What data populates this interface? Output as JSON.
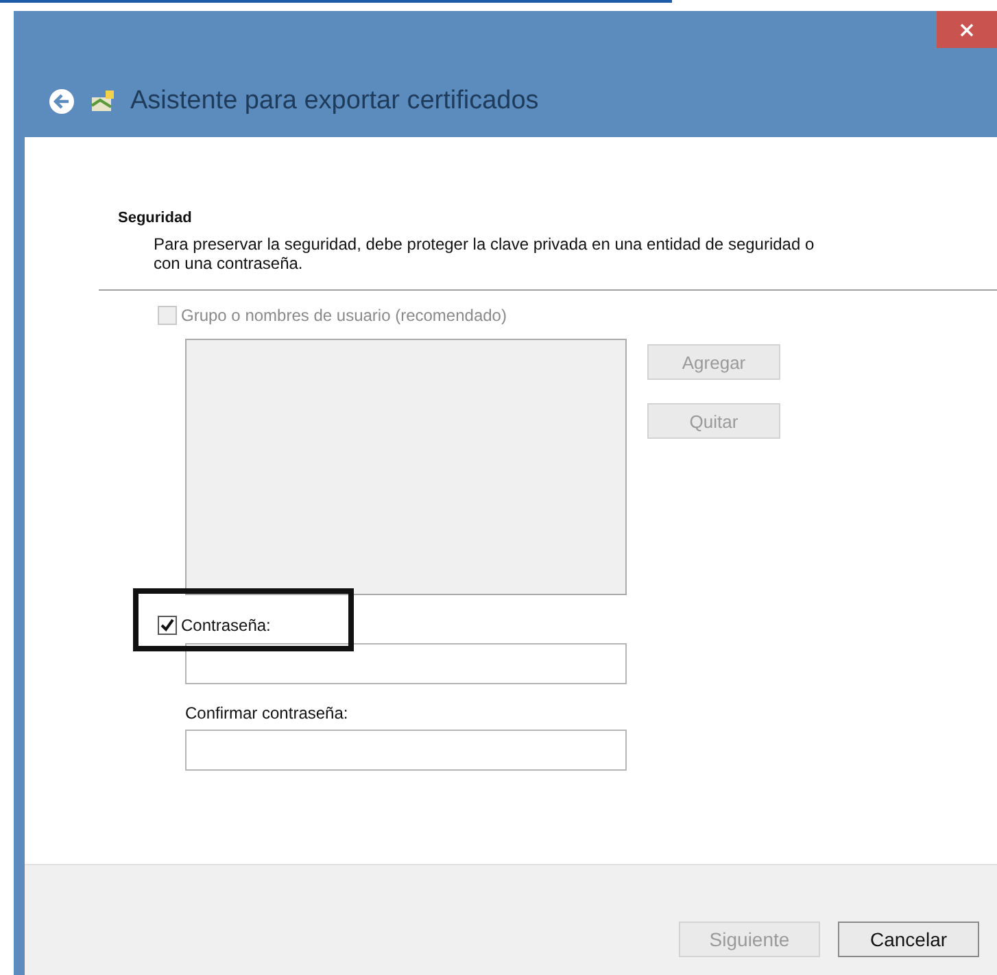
{
  "window": {
    "title": "Asistente para exportar certificados"
  },
  "section": {
    "heading": "Seguridad",
    "description": "Para preservar la seguridad, debe proteger la clave privada en una entidad de seguridad o con una contraseña."
  },
  "group_option": {
    "label": "Grupo o nombres de usuario (recomendado)",
    "checked": false,
    "disabled": true
  },
  "side_buttons": [
    {
      "label": "Agregar",
      "disabled": true
    },
    {
      "label": "Quitar",
      "disabled": true
    }
  ],
  "password_option": {
    "label": "Contraseña:",
    "checked": true,
    "disabled": false,
    "highlighted": true
  },
  "confirm": {
    "label": "Confirmar contraseña:"
  },
  "footer_buttons": [
    {
      "label": "Siguiente",
      "disabled": true
    },
    {
      "label": "Cancelar",
      "disabled": false
    }
  ]
}
